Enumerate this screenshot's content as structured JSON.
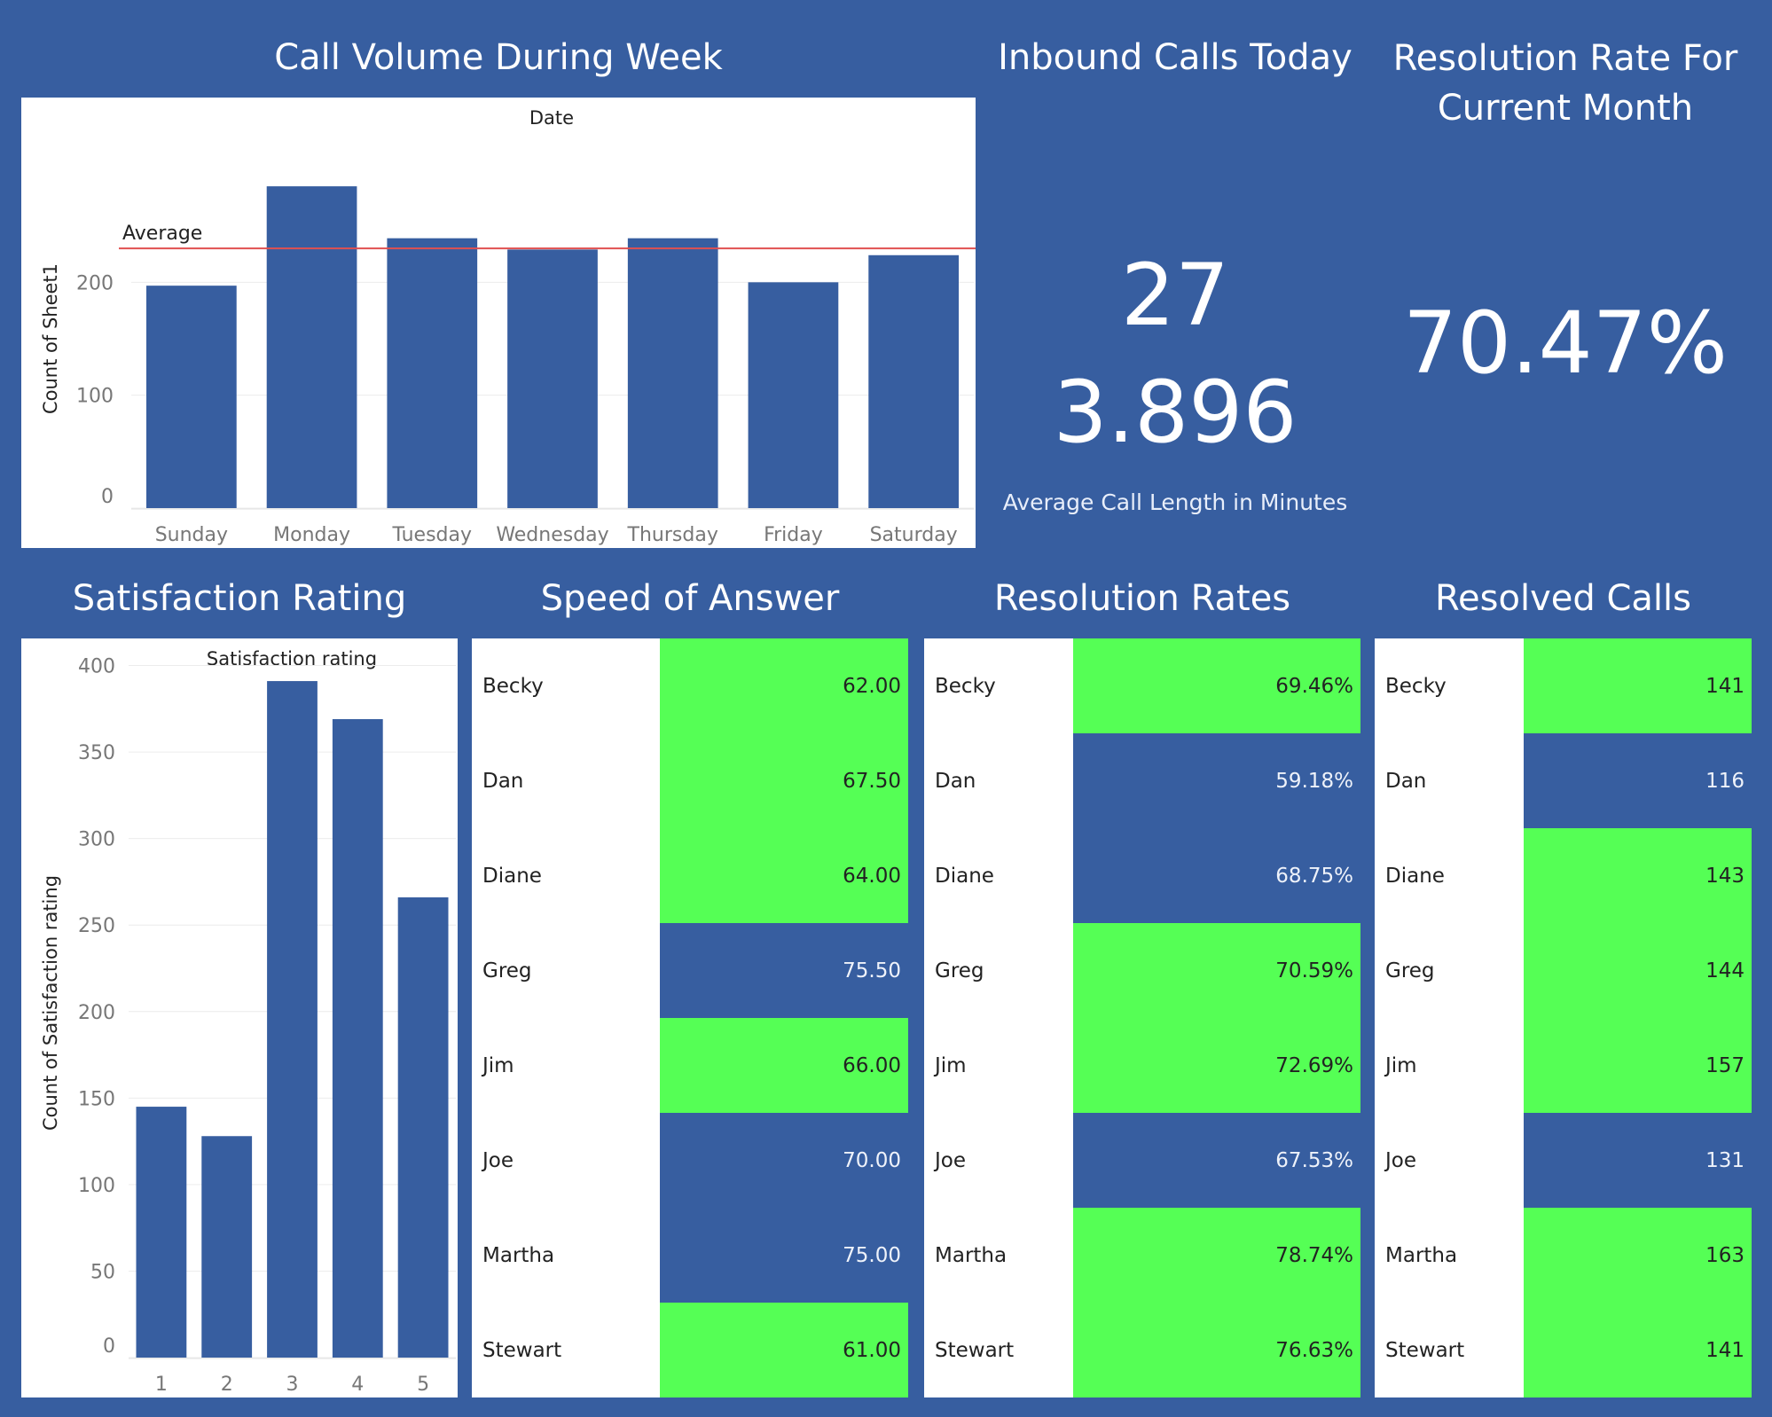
{
  "titles": {
    "call_volume": "Call Volume During Week",
    "inbound": "Inbound Calls Today",
    "resolution_rate": "Resolution Rate For Current Month",
    "satisfaction": "Satisfaction Rating",
    "speed": "Speed of Answer",
    "resolution_rates": "Resolution Rates",
    "resolved_calls": "Resolved Calls"
  },
  "kpis": {
    "inbound_calls": "27",
    "avg_call_length": "3.896",
    "avg_call_length_label": "Average Call Length in Minutes",
    "resolution_rate": "70.47%"
  },
  "colors": {
    "background": "#375ea0",
    "bar": "#375ea0",
    "highlight": "#55ff55",
    "average_line": "#e05050"
  },
  "chart_data": [
    {
      "type": "bar",
      "title": "Date",
      "ylabel": "Count of Sheet1",
      "categories": [
        "Sunday",
        "Monday",
        "Tuesday",
        "Wednesday",
        "Thursday",
        "Friday",
        "Saturday"
      ],
      "values": [
        197,
        285,
        239,
        229,
        239,
        200,
        224
      ],
      "yticks": [
        0,
        100,
        200
      ],
      "ylim": [
        0,
        300
      ],
      "reference_line": {
        "label": "Average",
        "value": 230
      }
    },
    {
      "type": "bar",
      "title": "Satisfaction rating",
      "ylabel": "Count of Satisfaction rating",
      "categories": [
        "1",
        "2",
        "3",
        "4",
        "5"
      ],
      "values": [
        145,
        128,
        391,
        369,
        266
      ],
      "yticks": [
        0,
        50,
        100,
        150,
        200,
        250,
        300,
        350,
        400
      ],
      "ylim": [
        0,
        410
      ]
    }
  ],
  "tables": {
    "speed": [
      {
        "name": "Becky",
        "value": "62.00",
        "hl": true
      },
      {
        "name": "Dan",
        "value": "67.50",
        "hl": true
      },
      {
        "name": "Diane",
        "value": "64.00",
        "hl": true
      },
      {
        "name": "Greg",
        "value": "75.50",
        "hl": false
      },
      {
        "name": "Jim",
        "value": "66.00",
        "hl": true
      },
      {
        "name": "Joe",
        "value": "70.00",
        "hl": false
      },
      {
        "name": "Martha",
        "value": "75.00",
        "hl": false
      },
      {
        "name": "Stewart",
        "value": "61.00",
        "hl": true
      }
    ],
    "resolution_rates": [
      {
        "name": "Becky",
        "value": "69.46%",
        "hl": true
      },
      {
        "name": "Dan",
        "value": "59.18%",
        "hl": false
      },
      {
        "name": "Diane",
        "value": "68.75%",
        "hl": false
      },
      {
        "name": "Greg",
        "value": "70.59%",
        "hl": true
      },
      {
        "name": "Jim",
        "value": "72.69%",
        "hl": true
      },
      {
        "name": "Joe",
        "value": "67.53%",
        "hl": false
      },
      {
        "name": "Martha",
        "value": "78.74%",
        "hl": true
      },
      {
        "name": "Stewart",
        "value": "76.63%",
        "hl": true
      }
    ],
    "resolved_calls": [
      {
        "name": "Becky",
        "value": "141",
        "hl": true
      },
      {
        "name": "Dan",
        "value": "116",
        "hl": false
      },
      {
        "name": "Diane",
        "value": "143",
        "hl": true
      },
      {
        "name": "Greg",
        "value": "144",
        "hl": true
      },
      {
        "name": "Jim",
        "value": "157",
        "hl": true
      },
      {
        "name": "Joe",
        "value": "131",
        "hl": false
      },
      {
        "name": "Martha",
        "value": "163",
        "hl": true
      },
      {
        "name": "Stewart",
        "value": "141",
        "hl": true
      }
    ]
  }
}
